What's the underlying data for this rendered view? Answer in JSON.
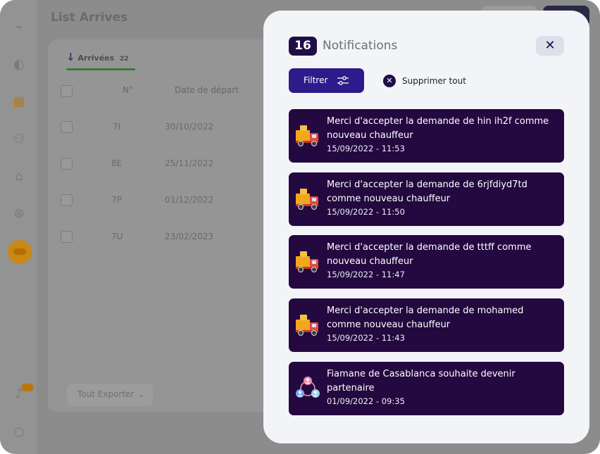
{
  "background": {
    "page_title": "List Arrives",
    "tab_label": "Arrivées",
    "tab_count": "22",
    "columns": [
      "N°",
      "Date de départ"
    ],
    "rows": [
      {
        "num": "7I",
        "date": "30/10/2022"
      },
      {
        "num": "8E",
        "date": "25/11/2022"
      },
      {
        "num": "7P",
        "date": "01/12/2022"
      },
      {
        "num": "7U",
        "date": "23/02/2023"
      }
    ],
    "export_label": "Tout Exporter"
  },
  "modal": {
    "count": "16",
    "title": "Notifications",
    "filter_label": "Filtrer",
    "delete_all_label": "Supprimer tout",
    "close_icon": "close-icon"
  },
  "notifications": [
    {
      "icon": "delivery-truck-icon",
      "text": "Merci d'accepter la demande de hin ih2f comme nouveau chauffeur",
      "time": "15/09/2022 - 11:53"
    },
    {
      "icon": "delivery-truck-icon",
      "text": "Merci d'accepter la demande de 6rjfdiyd7td comme nouveau chauffeur",
      "time": "15/09/2022 - 11:50"
    },
    {
      "icon": "delivery-truck-icon",
      "text": "Merci d'accepter la demande de tttff comme nouveau chauffeur",
      "time": "15/09/2022 - 11:47"
    },
    {
      "icon": "delivery-truck-icon",
      "text": "Merci d'accepter la demande de mohamed comme nouveau chauffeur",
      "time": "15/09/2022 - 11:43"
    },
    {
      "icon": "partner-network-icon",
      "text": "Fiamane de Casablanca souhaite devenir partenaire",
      "time": "01/09/2022 - 09:35"
    }
  ],
  "colors": {
    "modal_bg": "#f3f4f8",
    "notification_bg": "#23093f",
    "primary": "#2e1a8a",
    "overlay": "#8c8c8c"
  }
}
